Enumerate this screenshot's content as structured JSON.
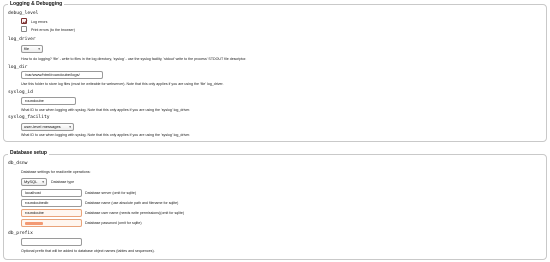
{
  "logging": {
    "legend": "Logging & Debugging",
    "debug_level": {
      "key": "debug_level",
      "options": [
        {
          "label": "Log errors",
          "checked": true
        },
        {
          "label": "Print errors (to the browser)",
          "checked": false
        }
      ]
    },
    "log_driver": {
      "key": "log_driver",
      "value": "file",
      "hint": "How to do logging? 'file' - write to files in the log directory, 'syslog' - use the syslog facility, 'stdout' write to the process' STDOUT file descriptor."
    },
    "log_dir": {
      "key": "log_dir",
      "value": "/var/www/html/roundcube/logs/",
      "hint": "Use this folder to store log files (must be writeable for webserver). Note that this only applies if you are using the 'file' log_driver."
    },
    "syslog_id": {
      "key": "syslog_id",
      "value": "roundcube",
      "hint": "What ID to use when logging with syslog. Note that this only applies if you are using the 'syslog' log_driver."
    },
    "syslog_facility": {
      "key": "syslog_facility",
      "value": "user-level messages",
      "hint": "What ID to use when logging with syslog. Note that this only applies if you are using the 'syslog' log_driver."
    }
  },
  "database": {
    "legend": "Database setup",
    "db_dsnw": {
      "key": "db_dsnw",
      "intro": "Database settings for read/write operations:",
      "type_value": "MySQL",
      "type_label": "Database type",
      "fields": [
        {
          "value": "localhost",
          "label": "Database server (omit for sqlite)"
        },
        {
          "value": "roundcubedb",
          "label": "Database name (use absolute path and filename for sqlite)"
        },
        {
          "value": "roundcube",
          "label": "Database user name (needs write permissions)(omit for sqlite)"
        },
        {
          "value": "",
          "label": "Database password (omit for sqlite)"
        }
      ]
    },
    "db_prefix": {
      "key": "db_prefix",
      "value": "",
      "hint": "Optional prefix that will be added to database object names (tables and sequences)."
    }
  }
}
